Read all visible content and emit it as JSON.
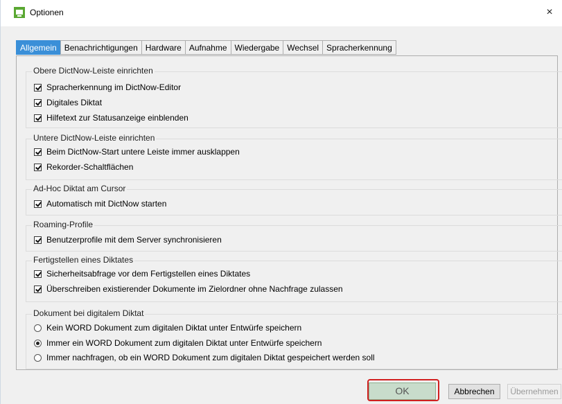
{
  "window": {
    "title": "Optionen",
    "close_label": "×"
  },
  "tabs": [
    {
      "label": "Allgemein",
      "active": true
    },
    {
      "label": "Benachrichtigungen",
      "active": false
    },
    {
      "label": "Hardware",
      "active": false
    },
    {
      "label": "Aufnahme",
      "active": false
    },
    {
      "label": "Wiedergabe",
      "active": false
    },
    {
      "label": "Wechsel",
      "active": false
    },
    {
      "label": "Spracherkennung",
      "active": false
    }
  ],
  "groups": {
    "obere": {
      "title": "Obere DictNow-Leiste einrichten",
      "options": [
        {
          "label": "Spracherkennung im DictNow-Editor",
          "checked": true
        },
        {
          "label": "Digitales Diktat",
          "checked": true
        },
        {
          "label": "Hilfetext zur Statusanzeige einblenden",
          "checked": true
        }
      ]
    },
    "untere": {
      "title": "Untere DictNow-Leiste einrichten",
      "options": [
        {
          "label": "Beim DictNow-Start untere Leiste immer ausklappen",
          "checked": true
        },
        {
          "label": "Rekorder-Schaltflächen",
          "checked": true
        }
      ]
    },
    "adhoc": {
      "title": "Ad-Hoc Diktat am Cursor",
      "options": [
        {
          "label": "Automatisch mit DictNow starten",
          "checked": true
        }
      ]
    },
    "roaming": {
      "title": "Roaming-Profile",
      "options": [
        {
          "label": "Benutzerprofile mit dem Server synchronisieren",
          "checked": true
        }
      ]
    },
    "fertig": {
      "title": "Fertigstellen eines Diktates",
      "options": [
        {
          "label": "Sicherheitsabfrage vor dem Fertigstellen eines Diktates",
          "checked": true
        },
        {
          "label": "Überschreiben existierender Dokumente im Zielordner ohne Nachfrage zulassen",
          "checked": true
        }
      ]
    },
    "dokument": {
      "title": "Dokument bei digitalem Diktat",
      "options": [
        {
          "label": "Kein WORD Dokument zum digitalen Diktat unter Entwürfe speichern",
          "selected": false
        },
        {
          "label": "Immer ein WORD Dokument zum digitalen Diktat unter Entwürfe speichern",
          "selected": true
        },
        {
          "label": "Immer nachfragen, ob ein WORD Dokument zum digitalen Diktat gespeichert werden soll",
          "selected": false
        }
      ]
    }
  },
  "buttons": {
    "ok": "OK",
    "cancel": "Abbrechen",
    "apply": "Übernehmen"
  },
  "colors": {
    "active_tab": "#3a8fd8",
    "highlight": "#d12020",
    "app_icon": "#5aa832"
  }
}
